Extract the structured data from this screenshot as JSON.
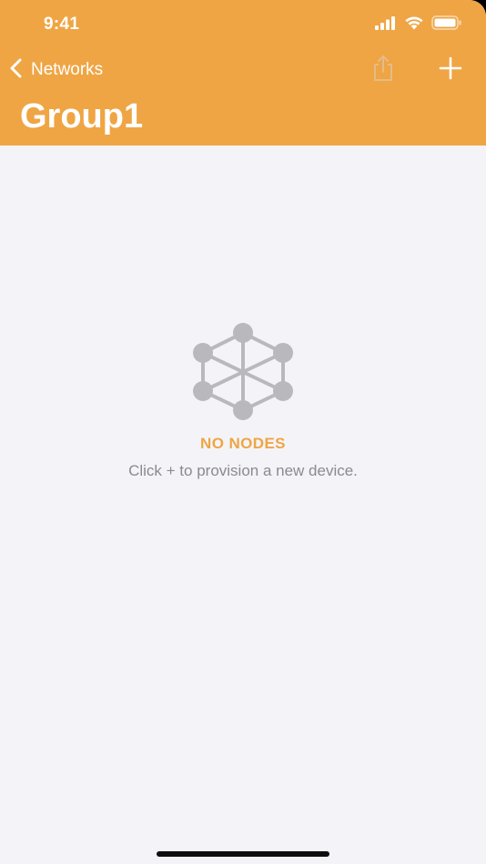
{
  "status_bar": {
    "time": "9:41",
    "icons": [
      "cellular-signal-icon",
      "wifi-icon",
      "battery-icon"
    ]
  },
  "nav": {
    "back_label": "Networks",
    "back_icon": "chevron-left-icon",
    "share_icon": "share-icon",
    "add_icon": "plus-icon",
    "title": "Group1"
  },
  "empty_state": {
    "icon": "mesh-nodes-icon",
    "title": "NO NODES",
    "subtitle": "Click + to provision a new device."
  },
  "colors": {
    "accent": "#efa544",
    "background": "#f4f4f8",
    "icon_gray": "#b9b9bd",
    "subtitle_gray": "#8a8a8f"
  }
}
